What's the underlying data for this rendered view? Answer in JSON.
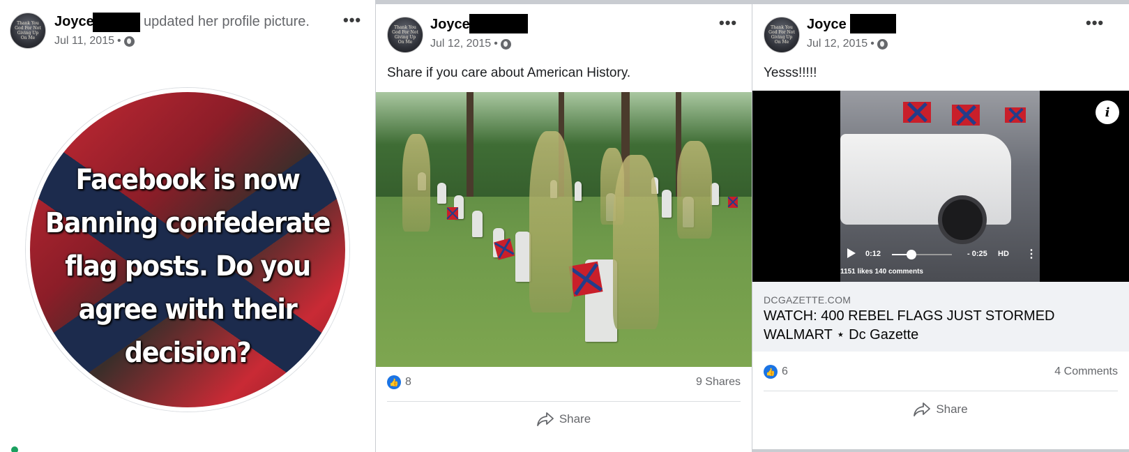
{
  "posts": [
    {
      "author": "Joyce",
      "action": "updated her profile picture.",
      "date": "Jul 11, 2015",
      "separator": "•",
      "more": "•••",
      "image_caption": "Facebook is now Banning confederate flag posts. Do you agree with their decision?"
    },
    {
      "author": "Joyce",
      "date": "Jul 12, 2015",
      "separator": "•",
      "more": "•••",
      "text": "Share if you care about American History.",
      "likes": "8",
      "shares": "9 Shares",
      "share_label": "Share"
    },
    {
      "author": "Joyce",
      "date": "Jul 12, 2015",
      "separator": "•",
      "more": "•••",
      "text": "Yesss!!!!!",
      "video": {
        "current_time": "0:12",
        "remaining": "- 0:25",
        "quality": "HD",
        "progress": 0.32,
        "stats": "1151 likes 140 comments"
      },
      "link": {
        "domain": "DCGAZETTE.COM",
        "title": "WATCH: 400 REBEL FLAGS JUST STORMED WALMART ⋆ Dc Gazette"
      },
      "likes": "6",
      "comments": "4 Comments",
      "share_label": "Share"
    }
  ],
  "avatar_text": "Thank You God For Not Giving Up On Me",
  "colors": {
    "like_blue": "#1b74e4",
    "meta_gray": "#65676b"
  },
  "icons": {
    "like": "thumbs-up-icon",
    "share": "share-arrow-icon",
    "privacy": "globe-icon",
    "info": "info-icon"
  }
}
